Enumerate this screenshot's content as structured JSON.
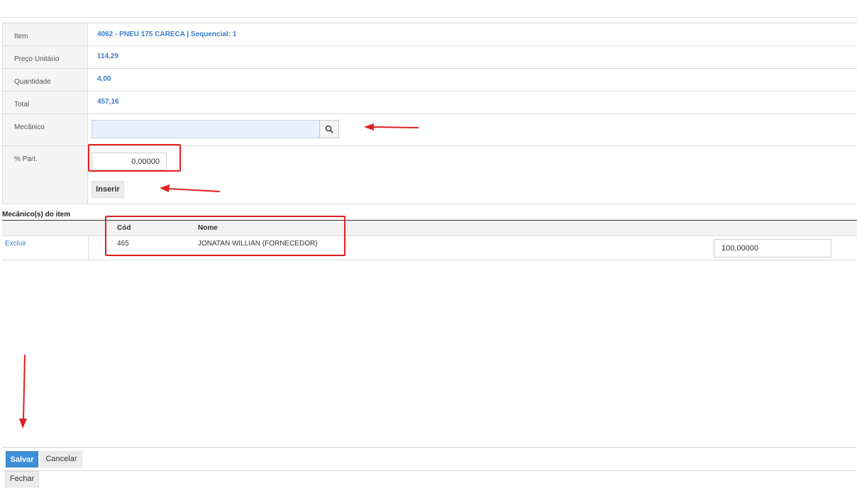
{
  "form": {
    "item_label": "Item",
    "item_value": "4062 - PNEU 175 CARECA | Sequencial: 1",
    "unit_price_label": "Preço Unitário",
    "unit_price_value": "114,29",
    "quantity_label": "Quantidade",
    "quantity_value": "4,00",
    "total_label": "Total",
    "total_value": "457,16",
    "mechanic_label": "Mecânico",
    "mechanic_value": "",
    "participation_label": "% Part.",
    "participation_value": "0,00000",
    "insert_label": "Inserir"
  },
  "mechanics": {
    "title": "Mecânico(s) do item",
    "columns": [
      "Cód",
      "Nome"
    ],
    "rows": [
      {
        "action": "Excluir",
        "code": "465",
        "name": "JONATAN WILLIAN (FORNECEDOR)",
        "participation": "100,00000"
      }
    ]
  },
  "footer": {
    "save_label": "Salvar",
    "cancel_label": "Cancelar",
    "close_label": "Fechar"
  },
  "annotations": {
    "color": "#e21f1f"
  }
}
